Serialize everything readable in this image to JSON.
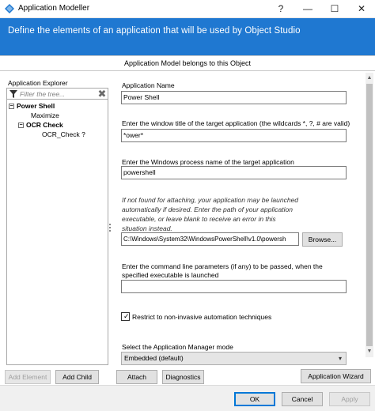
{
  "window": {
    "title": "Application Modeller",
    "help_glyph": "?",
    "minimize_glyph": "—",
    "maximize_glyph": "☐",
    "close_glyph": "✕",
    "icon": "app-modeller-icon",
    "accent_color": "#1f78d1"
  },
  "banner": {
    "text": "Define the elements of an application that will be used by Object Studio"
  },
  "object_bar": {
    "text": "Application Model belongs to this Object"
  },
  "explorer": {
    "label": "Application Explorer",
    "filter_placeholder": "Filter the tree...",
    "clear_glyph": "✖",
    "tree": {
      "root": {
        "label": "Power Shell",
        "toggle": "−"
      },
      "items": [
        {
          "label": "Maximize"
        },
        {
          "label": "OCR Check",
          "toggle": "−"
        },
        {
          "label": "OCR_Check ?"
        }
      ]
    },
    "add_element_label": "Add Element",
    "add_child_label": "Add Child"
  },
  "form": {
    "app_name_label": "Application Name",
    "app_name_value": "Power Shell",
    "window_title_label": "Enter the window title of the target application (the wildcards *, ?, # are valid)",
    "window_title_value": "*ower*",
    "process_name_label": "Enter the Windows process name of the target application",
    "process_name_value": "powershell",
    "launch_note": "If not found for attaching, your application may be launched automatically if desired. Enter the path of your application executable, or leave blank to receive an error in this situation instead.",
    "exe_path_value": "C:\\Windows\\System32\\WindowsPowerShell\\v1.0\\powersh",
    "browse_label": "Browse...",
    "cmdline_label": "Enter the command line parameters (if any) to be passed, when the specified executable is launched",
    "cmdline_value": "",
    "restrict_label": "Restrict to non-invasive automation techniques",
    "restrict_checked": true,
    "app_manager_label": "Select the Application Manager mode",
    "app_manager_value": "Embedded (default)",
    "attach_label": "Attach",
    "diagnostics_label": "Diagnostics",
    "wizard_label": "Application Wizard"
  },
  "footer": {
    "ok_label": "OK",
    "cancel_label": "Cancel",
    "apply_label": "Apply"
  }
}
